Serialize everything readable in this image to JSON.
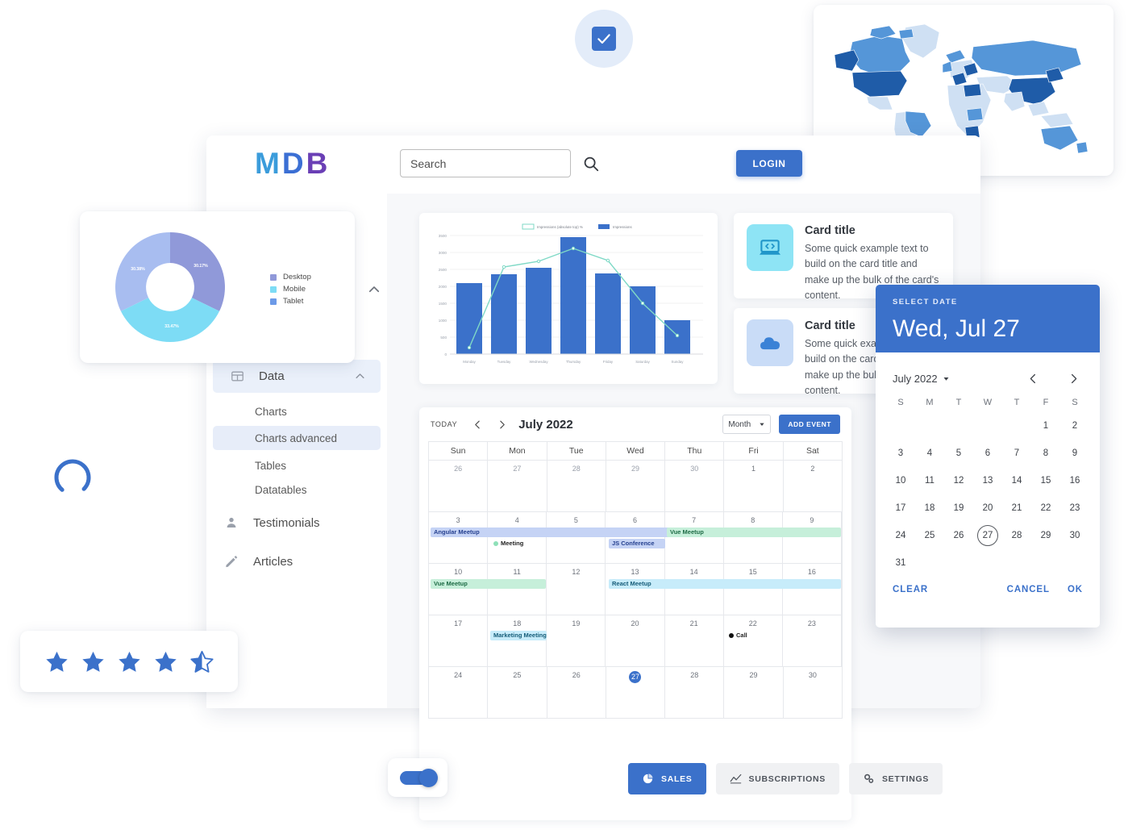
{
  "app": {
    "logo": {
      "m": "M",
      "d": "D",
      "b": "B"
    },
    "search": {
      "value": "Search",
      "placeholder": "Search"
    },
    "login_label": "LOGIN"
  },
  "sidebar": {
    "group": {
      "label": "Data",
      "icon": "table-icon",
      "chevron": "chevron-up-icon"
    },
    "sub_items": [
      {
        "label": "Charts",
        "active": false
      },
      {
        "label": "Charts advanced",
        "active": true
      },
      {
        "label": "Tables",
        "active": false
      },
      {
        "label": "Datatables",
        "active": false
      }
    ],
    "items": [
      {
        "label": "Testimonials",
        "icon": "person-icon"
      },
      {
        "label": "Articles",
        "icon": "pencil-icon"
      }
    ]
  },
  "cards": [
    {
      "icon": "laptop-code-icon",
      "thumb_bg": "#8ee4f5",
      "icon_color": "#2196c9",
      "title": "Card title",
      "text": "Some quick example text to build on the card title and make up the bulk of the card's content."
    },
    {
      "icon": "cloud-icon",
      "thumb_bg": "#c9dcf7",
      "icon_color": "#3b82d6",
      "title": "Card title",
      "text": "Some quick example text to build on the card title and make up the bulk of the card's content."
    }
  ],
  "calendar": {
    "today_label": "TODAY",
    "prev_icon": "chevron-left-icon",
    "next_icon": "chevron-right-icon",
    "title": "July 2022",
    "view_label": "Month",
    "view_caret": "caret-down-icon",
    "add_event_label": "ADD EVENT",
    "day_names": [
      "Sun",
      "Mon",
      "Tue",
      "Wed",
      "Thu",
      "Fri",
      "Sat"
    ],
    "weeks": [
      [
        {
          "num": "26",
          "inmonth": false
        },
        {
          "num": "27",
          "inmonth": false
        },
        {
          "num": "28",
          "inmonth": false
        },
        {
          "num": "29",
          "inmonth": false
        },
        {
          "num": "30",
          "inmonth": false
        },
        {
          "num": "1",
          "inmonth": true
        },
        {
          "num": "2",
          "inmonth": true
        }
      ],
      [
        {
          "num": "3",
          "inmonth": true
        },
        {
          "num": "4",
          "inmonth": true
        },
        {
          "num": "5",
          "inmonth": true
        },
        {
          "num": "6",
          "inmonth": true
        },
        {
          "num": "7",
          "inmonth": true
        },
        {
          "num": "8",
          "inmonth": true
        },
        {
          "num": "9",
          "inmonth": true
        }
      ],
      [
        {
          "num": "10",
          "inmonth": true
        },
        {
          "num": "11",
          "inmonth": true
        },
        {
          "num": "12",
          "inmonth": true
        },
        {
          "num": "13",
          "inmonth": true
        },
        {
          "num": "14",
          "inmonth": true
        },
        {
          "num": "15",
          "inmonth": true
        },
        {
          "num": "16",
          "inmonth": true
        }
      ],
      [
        {
          "num": "17",
          "inmonth": true
        },
        {
          "num": "18",
          "inmonth": true
        },
        {
          "num": "19",
          "inmonth": true
        },
        {
          "num": "20",
          "inmonth": true
        },
        {
          "num": "21",
          "inmonth": true
        },
        {
          "num": "22",
          "inmonth": true
        },
        {
          "num": "23",
          "inmonth": true
        }
      ],
      [
        {
          "num": "24",
          "inmonth": true
        },
        {
          "num": "25",
          "inmonth": true
        },
        {
          "num": "26",
          "inmonth": true
        },
        {
          "num": "27",
          "inmonth": true,
          "today": true
        },
        {
          "num": "28",
          "inmonth": true
        },
        {
          "num": "29",
          "inmonth": true
        },
        {
          "num": "30",
          "inmonth": true
        }
      ]
    ],
    "events": [
      {
        "label": "Angular Meetup",
        "week": 1,
        "start_col": 0,
        "span": 5,
        "row": 0,
        "style": "ev-blue"
      },
      {
        "label": "Vue Meetup",
        "week": 1,
        "start_col": 4,
        "span": 3,
        "row": 0,
        "style": "ev-green"
      },
      {
        "label": "Meeting",
        "week": 1,
        "start_col": 1,
        "span": 1,
        "row": 1,
        "style": "dot-green"
      },
      {
        "label": "JS Conference",
        "week": 1,
        "start_col": 3,
        "span": 1,
        "row": 1,
        "style": "ev-blue"
      },
      {
        "label": "Vue Meetup",
        "week": 2,
        "start_col": 0,
        "span": 2,
        "row": 0,
        "style": "ev-green"
      },
      {
        "label": "React Meetup",
        "week": 2,
        "start_col": 3,
        "span": 4,
        "row": 0,
        "style": "ev-cyan"
      },
      {
        "label": "Marketing Meeting",
        "week": 3,
        "start_col": 1,
        "span": 1,
        "row": 0,
        "style": "ev-cyan"
      },
      {
        "label": "Call",
        "week": 3,
        "start_col": 5,
        "span": 1,
        "row": 0,
        "style": "dot-black"
      }
    ]
  },
  "datepicker": {
    "kicker": "SELECT DATE",
    "selected_date": "Wed, Jul 27",
    "month_label": "July 2022",
    "prev_icon": "chevron-left-icon",
    "next_icon": "chevron-right-icon",
    "day_initials": [
      "S",
      "M",
      "T",
      "W",
      "T",
      "F",
      "S"
    ],
    "weeks": [
      [
        "",
        "",
        "",
        "",
        "",
        "1",
        "2"
      ],
      [
        "3",
        "4",
        "5",
        "6",
        "7",
        "8",
        "9"
      ],
      [
        "10",
        "11",
        "12",
        "13",
        "14",
        "15",
        "16"
      ],
      [
        "17",
        "18",
        "19",
        "20",
        "21",
        "22",
        "23"
      ],
      [
        "24",
        "25",
        "26",
        "27",
        "28",
        "29",
        "30"
      ],
      [
        "31",
        "",
        "",
        "",
        "",
        "",
        ""
      ]
    ],
    "selected_day": "27",
    "clear_label": "CLEAR",
    "cancel_label": "CANCEL",
    "ok_label": "OK"
  },
  "button_group": [
    {
      "label": "SALES",
      "icon": "pie-chart-icon",
      "active": true
    },
    {
      "label": "SUBSCRIPTIONS",
      "icon": "line-chart-icon",
      "active": false
    },
    {
      "label": "SETTINGS",
      "icon": "gears-icon",
      "active": false
    }
  ],
  "rating": {
    "filled": 4,
    "half": true,
    "total": 5,
    "color": "#3b71ca"
  },
  "toggle": {
    "checked": true,
    "color": "#3b71ca"
  },
  "checkbox": {
    "checked": true,
    "color": "#3b71ca"
  },
  "chart_data": [
    {
      "type": "bar",
      "id": "impressions-bar-chart",
      "title": "",
      "categories": [
        "Monday",
        "Tuesday",
        "Wednesday",
        "Thursday",
        "Friday",
        "Saturday",
        "Sunday"
      ],
      "series": [
        {
          "name": "Impressions",
          "type": "bar",
          "color": "#3b71ca",
          "values": [
            2100,
            2350,
            2550,
            3450,
            2380,
            1990,
            1000
          ]
        },
        {
          "name": "Impressions (absolute top) %",
          "type": "line",
          "color": "#7fd9c6",
          "values": [
            200,
            2570,
            2750,
            3120,
            2760,
            1500,
            560
          ]
        }
      ],
      "xlabel": "",
      "ylabel": "",
      "ylim": [
        0,
        3500
      ],
      "yticks": [
        0,
        500,
        1000,
        1500,
        2000,
        2500,
        3000,
        3500
      ],
      "grid": true,
      "legend": "top"
    },
    {
      "type": "pie",
      "id": "device-donut-chart",
      "title": "",
      "labels": [
        "Desktop",
        "Mobile",
        "Tablet"
      ],
      "values": [
        30.17,
        33.47,
        30.38
      ],
      "value_labels": [
        "30.17%",
        "33.47%",
        "30.38%"
      ],
      "colors": [
        "#9099d9",
        "#7ddcf5",
        "#a8bdf0"
      ],
      "legend": "right",
      "donut": true
    },
    {
      "type": "heatmap",
      "id": "world-choropleth-map",
      "title": "",
      "regions": [
        {
          "name": "United States",
          "level": "high"
        },
        {
          "name": "China",
          "level": "high"
        },
        {
          "name": "Alaska",
          "level": "high"
        },
        {
          "name": "Canada",
          "level": "medium"
        },
        {
          "name": "Russia",
          "level": "medium"
        },
        {
          "name": "Brazil",
          "level": "medium"
        },
        {
          "name": "Australia",
          "level": "medium"
        },
        {
          "name": "Greenland",
          "level": "low"
        },
        {
          "name": "Africa",
          "level": "low"
        }
      ],
      "colors": {
        "high": "#1f5ca8",
        "medium": "#5596d8",
        "low": "#cfe0f3"
      }
    }
  ]
}
